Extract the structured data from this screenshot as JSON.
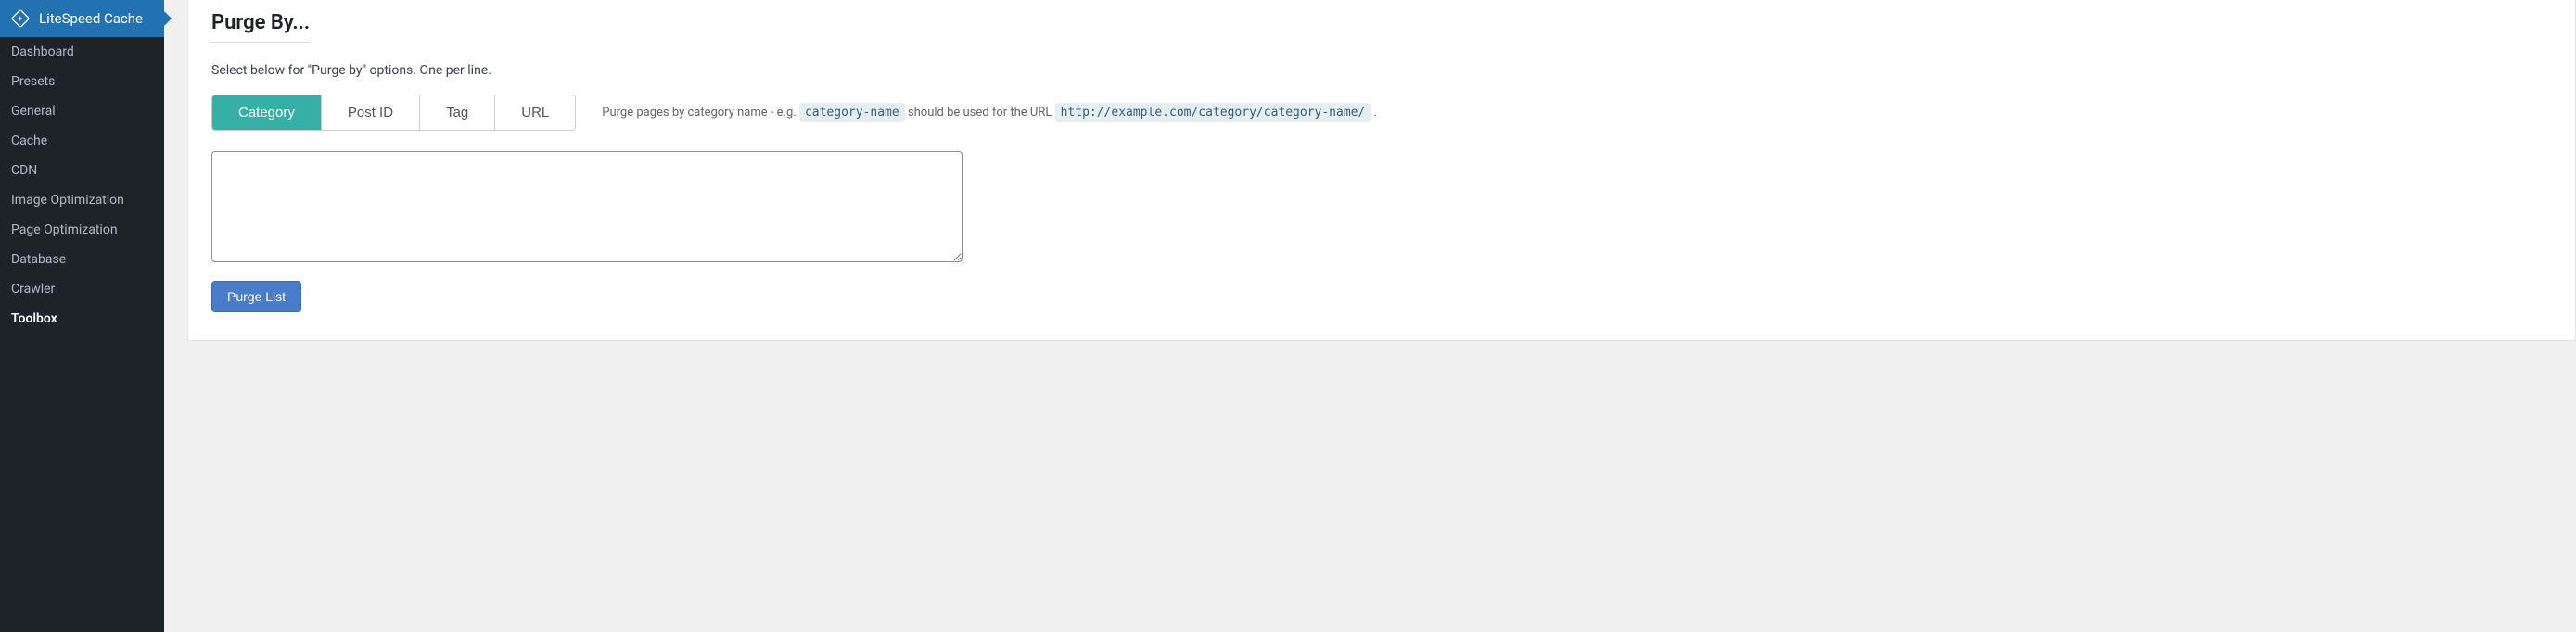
{
  "sidebar": {
    "brand_label": "LiteSpeed Cache",
    "items": [
      {
        "label": "Dashboard",
        "active": false
      },
      {
        "label": "Presets",
        "active": false
      },
      {
        "label": "General",
        "active": false
      },
      {
        "label": "Cache",
        "active": false
      },
      {
        "label": "CDN",
        "active": false
      },
      {
        "label": "Image Optimization",
        "active": false
      },
      {
        "label": "Page Optimization",
        "active": false
      },
      {
        "label": "Database",
        "active": false
      },
      {
        "label": "Crawler",
        "active": false
      },
      {
        "label": "Toolbox",
        "active": true
      }
    ]
  },
  "main": {
    "section_title": "Purge By...",
    "description": "Select below for \"Purge by\" options. One per line.",
    "tabs": [
      {
        "label": "Category",
        "active": true
      },
      {
        "label": "Post ID",
        "active": false
      },
      {
        "label": "Tag",
        "active": false
      },
      {
        "label": "URL",
        "active": false
      }
    ],
    "help_text_pre": "Purge pages by category name - e.g. ",
    "help_code1": "category-name",
    "help_text_mid": " should be used for the URL ",
    "help_code2": "http://example.com/category/category-name/",
    "help_text_post": " .",
    "textarea_value": "",
    "purge_button_label": "Purge List"
  }
}
